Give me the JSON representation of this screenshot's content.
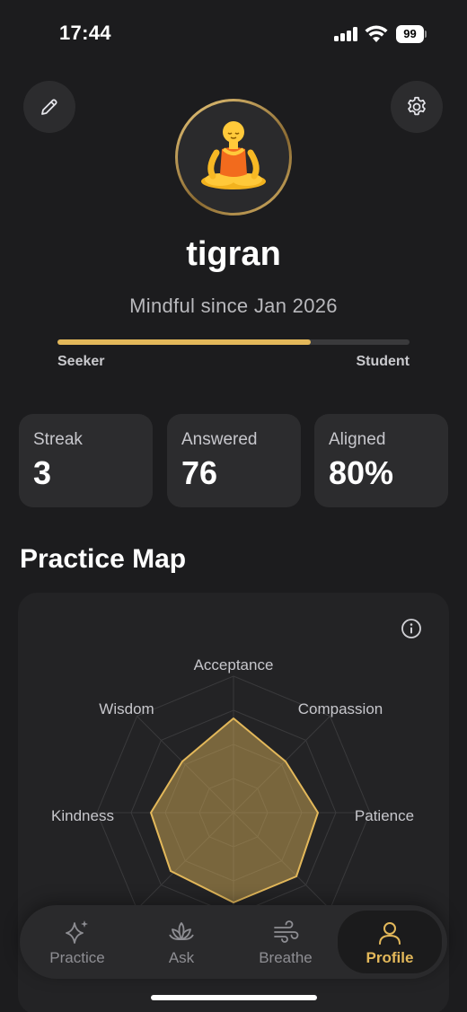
{
  "status_bar": {
    "time": "17:44",
    "battery": "99"
  },
  "profile": {
    "avatar_emoji": "🧘",
    "username": "tigran",
    "since": "Mindful since Jan 2026",
    "level_start": "Seeker",
    "level_end": "Student",
    "level_progress": 0.72
  },
  "stats": [
    {
      "label": "Streak",
      "value": "3"
    },
    {
      "label": "Answered",
      "value": "76"
    },
    {
      "label": "Aligned",
      "value": "80%"
    }
  ],
  "practice_map": {
    "title": "Practice Map",
    "axes": [
      "Acceptance",
      "Compassion",
      "Patience",
      "Kindness",
      "Wisdom"
    ]
  },
  "tabs": [
    {
      "label": "Practice",
      "icon": "sparkles-icon"
    },
    {
      "label": "Ask",
      "icon": "lotus-icon"
    },
    {
      "label": "Breathe",
      "icon": "wind-icon"
    },
    {
      "label": "Profile",
      "icon": "person-icon"
    }
  ],
  "colors": {
    "accent": "#e3b85a",
    "background": "#1c1c1e",
    "card": "#2c2c2e"
  }
}
